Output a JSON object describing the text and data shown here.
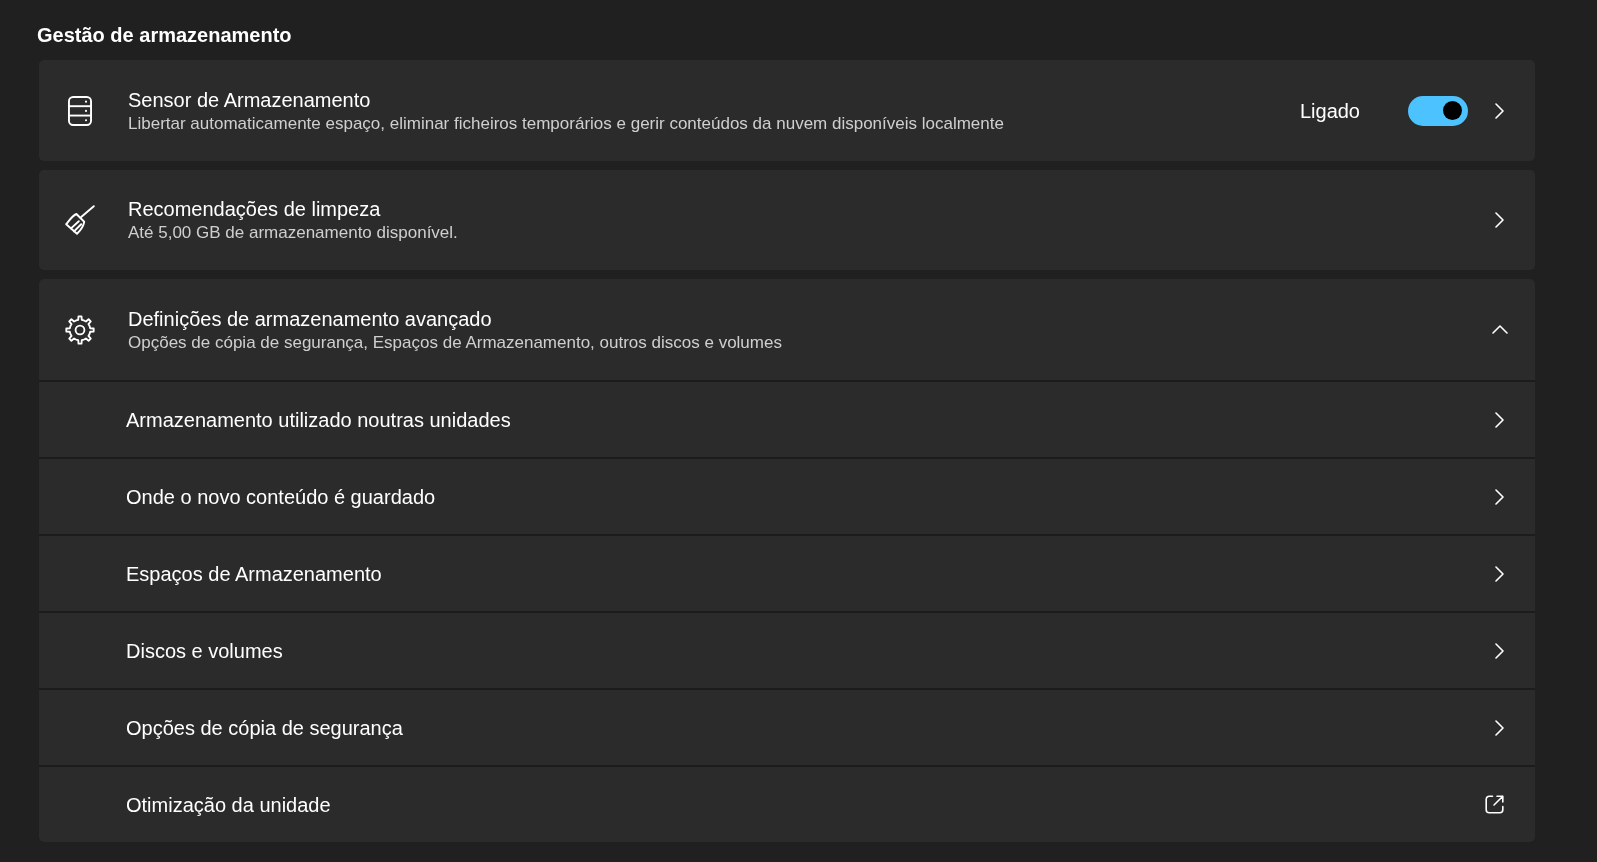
{
  "section_title": "Gestão de armazenamento",
  "cards": [
    {
      "kind": "toggle",
      "title": "Sensor de Armazenamento",
      "subtitle": "Libertar automaticamente espaço, eliminar ficheiros temporários e gerir conteúdos da nuvem disponíveis localmente",
      "toggle": {
        "label": "Ligado",
        "on": true
      }
    },
    {
      "kind": "link",
      "title": "Recomendações de limpeza",
      "subtitle": "Até 5,00 GB de armazenamento disponível."
    },
    {
      "kind": "expander",
      "title": "Definições de armazenamento avançado",
      "subtitle": "Opções de cópia de segurança, Espaços de Armazenamento, outros discos e volumes",
      "expanded": true,
      "children": [
        {
          "kind": "link",
          "label": "Armazenamento utilizado noutras unidades"
        },
        {
          "kind": "link",
          "label": "Onde o novo conteúdo é guardado"
        },
        {
          "kind": "link",
          "label": "Espaços de Armazenamento"
        },
        {
          "kind": "link",
          "label": "Discos e volumes"
        },
        {
          "kind": "link",
          "label": "Opções de cópia de segurança"
        },
        {
          "kind": "external",
          "label": "Otimização da unidade"
        }
      ]
    }
  ]
}
